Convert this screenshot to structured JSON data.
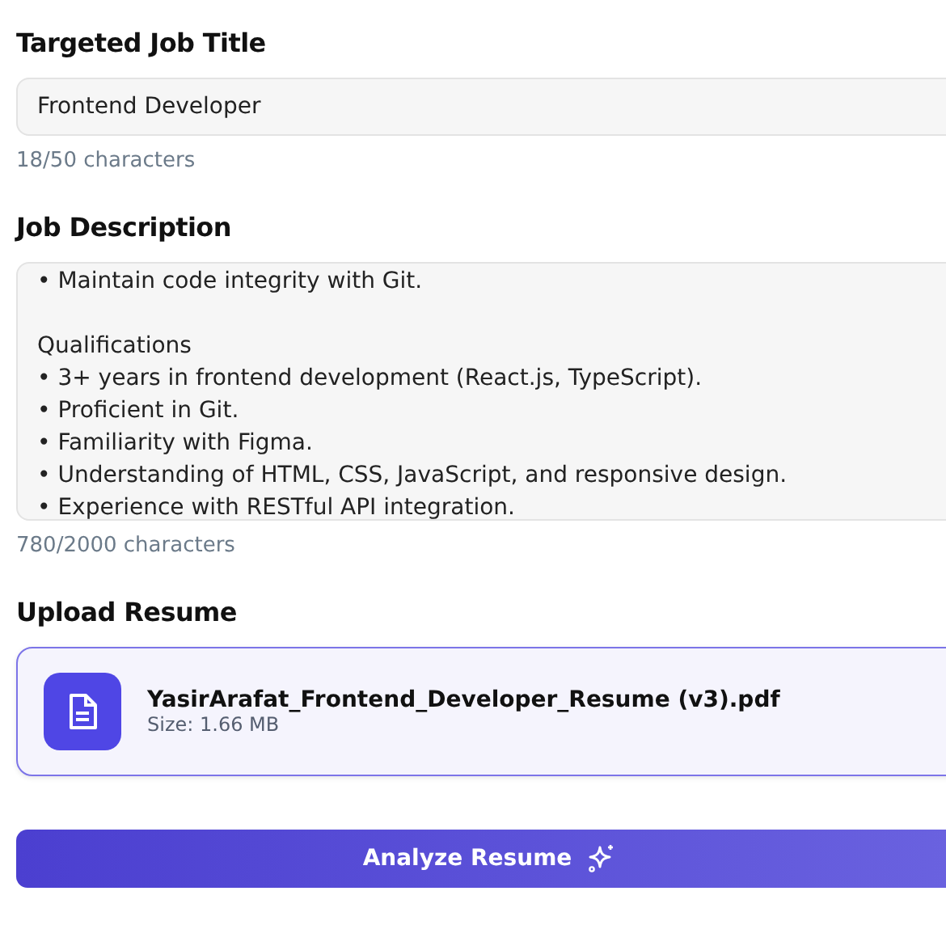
{
  "title_section": {
    "label": "Targeted Job Title",
    "value": "Frontend Developer",
    "counter": "18/50 characters"
  },
  "description_section": {
    "label": "Job Description",
    "paragraphs": [
      [
        "• Maintain code integrity with Git."
      ],
      [
        "Qualifications",
        "• 3+ years in frontend development (React.js, TypeScript).",
        "• Proficient in Git.",
        "• Familiarity with Figma.",
        "• Understanding of HTML, CSS, JavaScript, and responsive design.",
        "• Experience with RESTful API integration."
      ]
    ],
    "counter": "780/2000 characters"
  },
  "upload_section": {
    "label": "Upload Resume",
    "file_name": "YasirArafat_Frontend_Developer_Resume (v3).pdf",
    "file_size": "Size: 1.66 MB"
  },
  "analyze_button": {
    "label": "Analyze Resume"
  }
}
